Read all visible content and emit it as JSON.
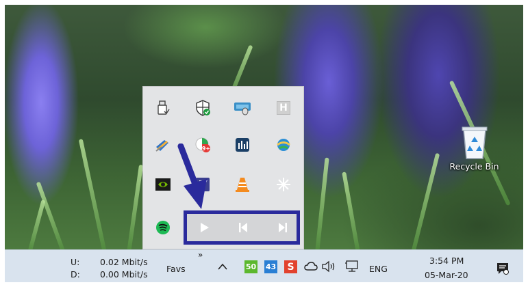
{
  "tray": {
    "usb_icon": "usb-eject-icon",
    "defender_icon": "windows-security-icon",
    "mouse_icon": "mouse-icon",
    "hotkey_label": "H",
    "pen_icon": "pen-tablet-icon",
    "badge_icon": "notification-badge-icon",
    "equalizer_icon": "equalizer-icon",
    "network_app_icon": "network-globe-icon",
    "nvidia_icon": "nvidia-icon",
    "app_icon": "app-icon",
    "vlc_icon": "vlc-cone-icon",
    "star_icon": "snowflake-star-icon",
    "spotify_icon": "spotify-icon"
  },
  "media_controls": {
    "play": "play-icon",
    "previous": "previous-track-icon",
    "next": "next-track-icon"
  },
  "desktop": {
    "recycle_bin_label": "Recycle Bin"
  },
  "taskbar": {
    "upload_label": "U:",
    "download_label": "D:",
    "upload_speed": "0.02 Mbit/s",
    "download_speed": "0.00 Mbit/s",
    "favs_label": "Favs",
    "overflow_chevron": "»",
    "show_hidden_caret": "^",
    "badge_green": "50",
    "badge_blue": "43",
    "badge_red": "S",
    "language": "ENG",
    "time": "3:54 PM",
    "date": "05-Mar-20"
  },
  "colors": {
    "highlight_box": "#2a2a9c",
    "taskbar_bg": "#d9e3ee",
    "badge_green": "#5cb82e",
    "badge_blue": "#2a7fd4",
    "badge_red": "#e2422e"
  }
}
